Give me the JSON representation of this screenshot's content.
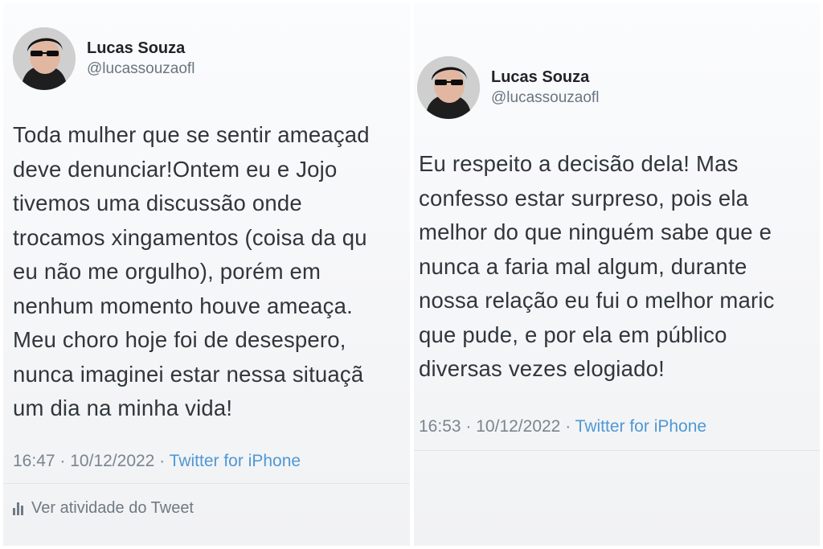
{
  "colors": {
    "name": "#202327",
    "body_text": "#30363b",
    "muted": "#7a858f",
    "link": "#4f98d4"
  },
  "tweets": [
    {
      "author": {
        "name": "Lucas Souza",
        "handle": "@lucassouzaofl",
        "avatar_icon": "avatar-sunglasses"
      },
      "lines": [
        "Toda mulher que se sentir ameaçad",
        "deve denunciar!Ontem eu e Jojo",
        "tivemos uma discussão onde",
        "trocamos xingamentos (coisa da qu",
        "eu não me orgulho), porém em",
        "nenhum momento houve ameaça.",
        "Meu choro hoje foi de desespero,",
        "nunca imaginei estar nessa situaçã",
        "um dia na minha vida!"
      ],
      "time": "16:47",
      "date": "10/12/2022",
      "dot": "·",
      "source": "Twitter for iPhone",
      "activity_icon": "bar-chart-icon",
      "activity_label": "Ver atividade do Tweet"
    },
    {
      "author": {
        "name": "Lucas Souza",
        "handle": "@lucassouzaofl",
        "avatar_icon": "avatar-sunglasses"
      },
      "lines": [
        "Eu respeito a decisão dela! Mas",
        "confesso estar surpreso, pois ela",
        "melhor do que ninguém sabe que e",
        "nunca a faria mal algum, durante",
        "nossa relação eu fui o melhor maric",
        "que pude, e por ela em público",
        "diversas vezes elogiado!"
      ],
      "time": "16:53",
      "date": "10/12/2022",
      "dot": "·",
      "source": "Twitter for iPhone"
    }
  ]
}
